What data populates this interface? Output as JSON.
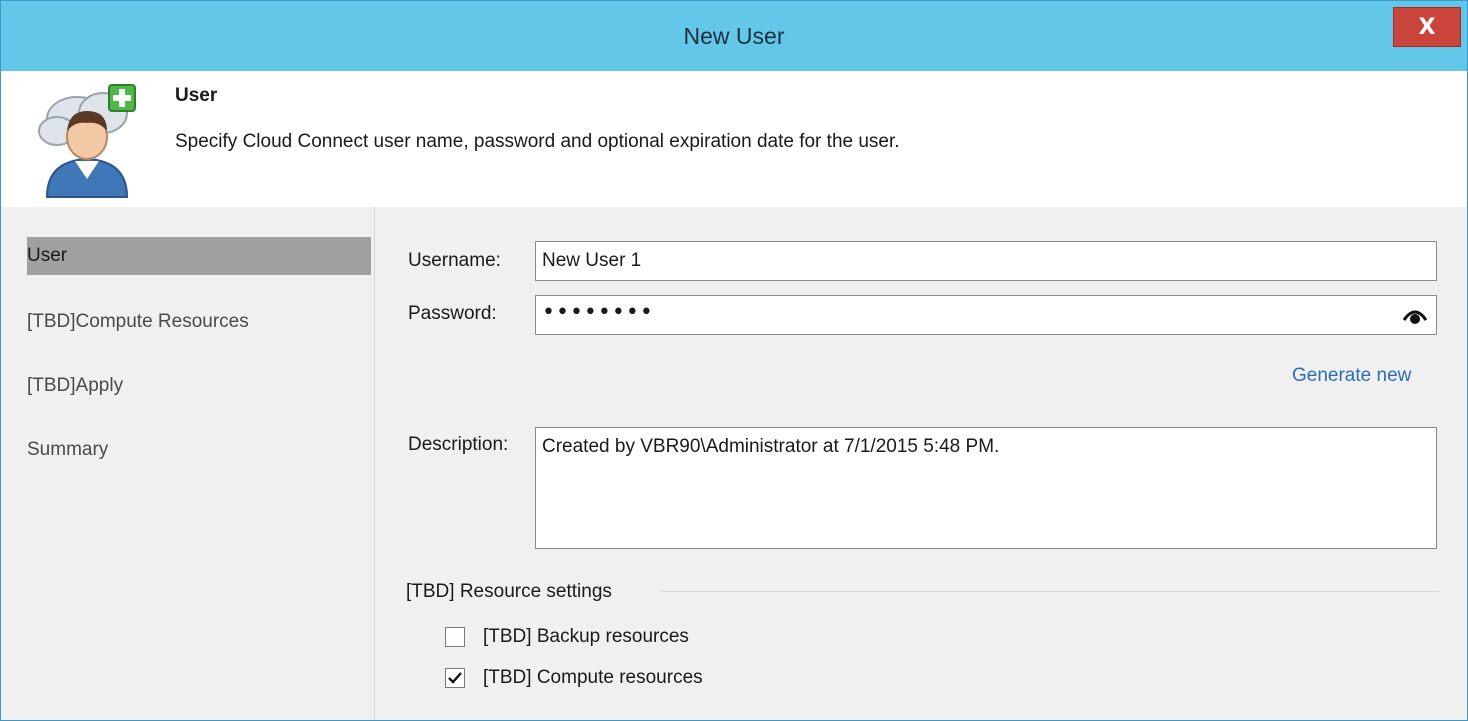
{
  "window": {
    "title": "New User",
    "close_label": "X"
  },
  "header": {
    "title": "User",
    "description": "Specify Cloud Connect user name, password and optional expiration date for the user.",
    "icon": "user-add-icon"
  },
  "sidebar": {
    "items": [
      {
        "label": "User",
        "active": true
      },
      {
        "label": "[TBD]Compute Resources",
        "active": false
      },
      {
        "label": "[TBD]Apply",
        "active": false
      },
      {
        "label": "Summary",
        "active": false
      }
    ]
  },
  "form": {
    "username_label": "Username:",
    "username_value": "New User 1",
    "password_label": "Password:",
    "password_mask": "••••••••",
    "generate_link": "Generate new",
    "description_label": "Description:",
    "description_value": "Created by VBR90\\Administrator at 7/1/2015 5:48 PM."
  },
  "resources": {
    "section_title": "[TBD] Resource settings",
    "backup_label": "[TBD] Backup resources",
    "backup_checked": false,
    "compute_label": "[TBD] Compute resources",
    "compute_checked": true
  },
  "colors": {
    "titlebar": "#62c7e8",
    "close_button": "#c9443a",
    "link": "#2a6fb6",
    "active_nav": "#a0a0a0"
  }
}
